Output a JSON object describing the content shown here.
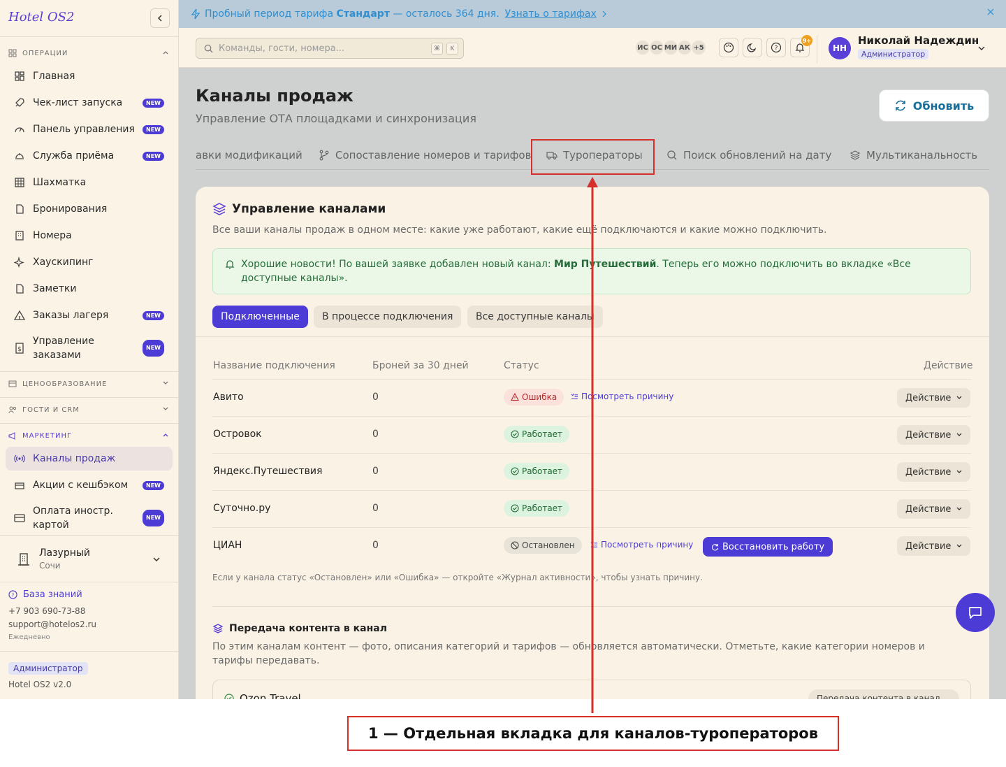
{
  "app": {
    "title": "Hotel OS2"
  },
  "sidebar": {
    "sections": {
      "operations": "ОПЕРАЦИИ",
      "pricing": "ЦЕНООБРАЗОВАНИЕ",
      "guests": "ГОСТИ И CRM",
      "marketing": "МАРКЕТИНГ"
    },
    "items": [
      {
        "label": "Главная",
        "icon": "dashboard-icon",
        "new": false
      },
      {
        "label": "Чек-лист запуска",
        "icon": "rocket-icon",
        "new": true
      },
      {
        "label": "Панель управления",
        "icon": "gauge-icon",
        "new": true
      },
      {
        "label": "Служба приёма",
        "icon": "concierge-bell-icon",
        "new": true
      },
      {
        "label": "Шахматка",
        "icon": "grid-icon",
        "new": false
      },
      {
        "label": "Бронирования",
        "icon": "document-icon",
        "new": false
      },
      {
        "label": "Номера",
        "icon": "building-icon",
        "new": false
      },
      {
        "label": "Хаускипинг",
        "icon": "sparkles-icon",
        "new": false
      },
      {
        "label": "Заметки",
        "icon": "note-icon",
        "new": false
      },
      {
        "label": "Заказы лагеря",
        "icon": "tent-icon",
        "new": true
      },
      {
        "label": "Управление заказами",
        "icon": "receipt-icon",
        "new": true
      }
    ],
    "marketing_items": [
      {
        "label": "Каналы продаж",
        "icon": "radio-icon",
        "new": false,
        "selected": true
      },
      {
        "label": "Акции с кешбэком",
        "icon": "cashback-icon",
        "new": true
      },
      {
        "label": "Оплата иностр. картой",
        "icon": "credit-card-icon",
        "new": true
      }
    ],
    "new_badge": "NEW",
    "hotel": {
      "name": "Лазурный",
      "city": "Сочи"
    },
    "footer": {
      "kb": "База знаний",
      "phone": "+7 903 690-73-88",
      "email": "support@hotelos2.ru",
      "schedule": "Ежедневно",
      "role": "Администратор",
      "version": "Hotel OS2 v2.0"
    }
  },
  "banner": {
    "prefix": "Пробный период тарифа",
    "plan": "Стандарт",
    "suffix": "— осталось 364 дня.",
    "link": "Узнать о тарифах"
  },
  "header": {
    "search_placeholder": "Команды, гости, номера...",
    "kbd1": "⌘",
    "kbd2": "K",
    "avatars": [
      "ИС",
      "ОС",
      "МИ",
      "АК",
      "+5"
    ],
    "notif_count": "9+",
    "user": {
      "initials": "НН",
      "name": "Николай Надеждин",
      "role": "Администратор"
    }
  },
  "page": {
    "title": "Каналы продаж",
    "subtitle": "Управление ОТА площадками и синхронизация",
    "refresh": "Обновить",
    "tabs": [
      "авки модификаций",
      "Сопоставление номеров и тарифов",
      "Туроператоры",
      "Поиск обновлений на дату",
      "Мультиканальность"
    ]
  },
  "card": {
    "title": "Управление каналами",
    "desc": "Все ваши каналы продаж в одном месте: какие уже работают, какие ещё подключаются и какие можно подключить.",
    "notice_pre": "Хорошие новости! По вашей заявке добавлен новый канал: ",
    "notice_bold": "Мир Путешествий",
    "notice_post": ". Теперь его можно подключить во вкладке «Все доступные каналы».",
    "pills": [
      "Подключенные",
      "В процессе подключения",
      "Все доступные каналы"
    ],
    "columns": [
      "Название подключения",
      "Броней за 30 дней",
      "Статус",
      "Действие"
    ],
    "rows": [
      {
        "name": "Авито",
        "bookings": "0",
        "status": "Ошибка",
        "reason": "Посмотреть причину"
      },
      {
        "name": "Островок",
        "bookings": "0",
        "status": "Работает"
      },
      {
        "name": "Яндекс.Путешествия",
        "bookings": "0",
        "status": "Работает"
      },
      {
        "name": "Суточно.ру",
        "bookings": "0",
        "status": "Работает"
      },
      {
        "name": "ЦИАН",
        "bookings": "0",
        "status": "Остановлен",
        "reason": "Посмотреть причину",
        "restore": "Восстановить работу"
      }
    ],
    "action_label": "Действие",
    "hint": "Если у канала статус «Остановлен» или «Ошибка» — откройте «Журнал активности», чтобы узнать причину.",
    "content_title": "Передача контента в канал",
    "content_desc": "По этим каналам контент — фото, описания категорий и тарифов — обновляется автоматически. Отметьте, какие категории номеров и тарифы передавать.",
    "content_channel": "Ozon Travel",
    "content_select": "Передача контента в канал"
  },
  "annotation": {
    "label": "1 — Отдельная вкладка для каналов-туроператоров"
  },
  "colors": {
    "accent": "#4d3bd6",
    "annotation": "#d6302b",
    "banner": "#b9cbd9"
  }
}
